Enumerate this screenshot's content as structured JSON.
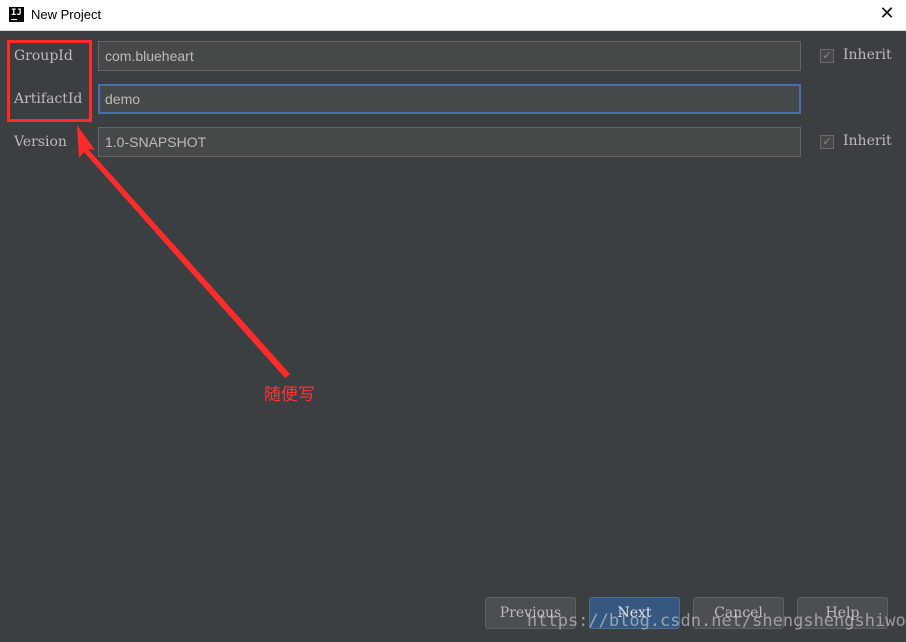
{
  "window": {
    "title": "New Project",
    "icon_text": "IJ",
    "close_glyph": "✕"
  },
  "form": {
    "groupid": {
      "label": "GroupId",
      "value": "com.blueheart"
    },
    "artifactid": {
      "label": "ArtifactId",
      "value": "demo"
    },
    "version": {
      "label": "Version",
      "value": "1.0-SNAPSHOT"
    },
    "inherit_label": "Inherit",
    "check_glyph": "✓"
  },
  "annotation": {
    "text": "随便写",
    "color": "#ff2a2a"
  },
  "buttons": {
    "previous": "Previous",
    "next": "Next",
    "cancel": "Cancel",
    "help": "Help"
  },
  "watermark": "https://blog.csdn.net/shengshengshiwo",
  "colors": {
    "background": "#3c3f41",
    "field_bg": "#45494a",
    "focus_border": "#4b6eaf",
    "primary_button": "#365880"
  }
}
